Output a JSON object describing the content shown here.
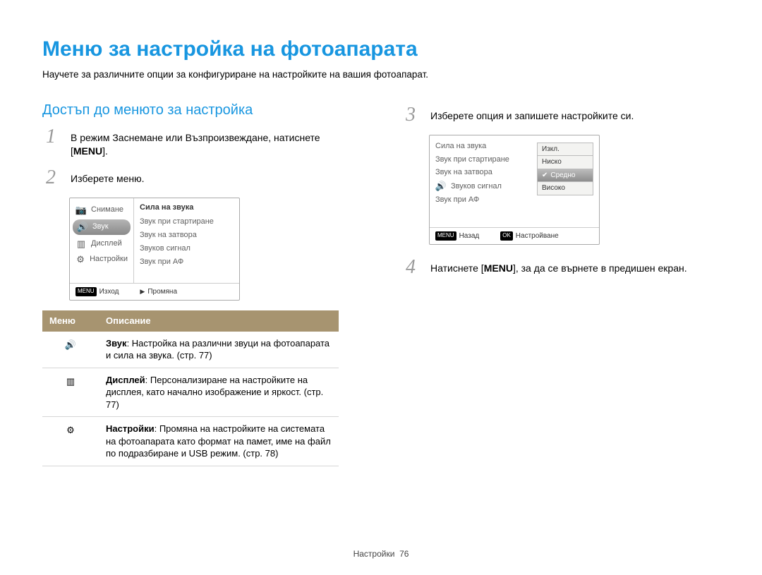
{
  "page": {
    "title": "Меню за настройка на фотоапарата",
    "intro": "Научете за различните опции за конфигуриране на настройките на вашия фотоапарат.",
    "section_title": "Достъп до менюто за настройка"
  },
  "steps": {
    "s1_num": "1",
    "s1_a": "В режим Заснемане или Възпроизвеждане, натиснете [",
    "s1_menu": "MENU",
    "s1_b": "].",
    "s2_num": "2",
    "s2": "Изберете меню.",
    "s3_num": "3",
    "s3": "Изберете опция и запишете настройките си.",
    "s4_num": "4",
    "s4_a": "Натиснете [",
    "s4_menu": "MENU",
    "s4_b": "], за да се върнете в предишен екран."
  },
  "ui1": {
    "left": {
      "i0": "Снимане",
      "i1": "Звук",
      "i2": "Дисплей",
      "i3": "Настройки"
    },
    "right_title": "Сила на звука",
    "right": {
      "r0": "Звук при стартиране",
      "r1": "Звук на затвора",
      "r2": "Звуков сигнал",
      "r3": "Звук при АФ"
    },
    "foot_menu_tag": "MENU",
    "foot_left": "Изход",
    "foot_right": "Промяна"
  },
  "ui2": {
    "left": {
      "l0": "Сила на звука",
      "l1": "Звук при стартиране",
      "l2": "Звук на затвора",
      "l3": "Звуков сигнал",
      "l4": "Звук при АФ"
    },
    "opts": {
      "o0": "Изкл.",
      "o1": "Ниско",
      "o2": "Средно",
      "o3": "Високо"
    },
    "foot_menu_tag": "MENU",
    "foot_left": "Назад",
    "foot_ok_tag": "OK",
    "foot_right": "Настройване"
  },
  "table": {
    "h1": "Меню",
    "h2": "Описание",
    "r1_b": "Звук",
    "r1": ": Настройка на различни звуци на фотоапарата и сила на звука. (стр. 77)",
    "r2_b": "Дисплей",
    "r2": ": Персонализиране на настройките на дисплея, като начално изображение и яркост. (стр. 77)",
    "r3_b": "Настройки",
    "r3": ": Промяна на настройките на системата на фотоапарата като формат на памет, име на файл по подразбиране и USB режим. (стр. 78)"
  },
  "footer": {
    "label": "Настройки",
    "page": "76"
  },
  "icons": {
    "camera": "📷",
    "speaker": "🔊",
    "display": "▥",
    "gear": "⚙",
    "play": "▶",
    "check": "✔"
  }
}
